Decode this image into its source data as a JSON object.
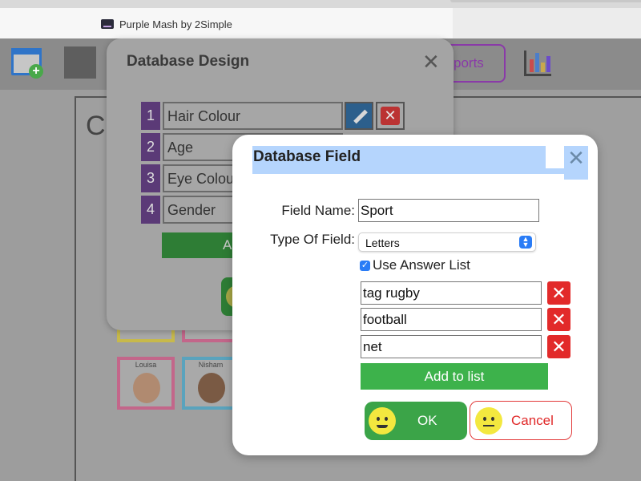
{
  "browser": {
    "tab_title": "Purple Mash by 2Simple"
  },
  "toolbar": {
    "reports_label": "ports"
  },
  "canvas": {
    "partial_heading": "C"
  },
  "cards": [
    {
      "name": "Louisa"
    },
    {
      "name": "Nisham"
    }
  ],
  "design_dialog": {
    "title": "Database Design",
    "fields": [
      {
        "num": "1",
        "name": "Hair Colour"
      },
      {
        "num": "2",
        "name": "Age"
      },
      {
        "num": "3",
        "name": "Eye Colour"
      },
      {
        "num": "4",
        "name": "Gender"
      }
    ],
    "add_partial": "A"
  },
  "field_dialog": {
    "title": "Database Field",
    "field_name_label": "Field Name:",
    "field_name_value": "Sport",
    "type_label": "Type Of Field:",
    "type_value": "Letters",
    "use_answer_list_label": "Use Answer List",
    "use_answer_list_checked": true,
    "answers": [
      "tag rugby",
      "football",
      "net"
    ],
    "add_to_list_label": "Add to list",
    "ok_label": "OK",
    "cancel_label": "Cancel"
  },
  "colors": {
    "accent_purple": "#8a3aa8",
    "ok_green": "#3ba448",
    "delete_red": "#e22a2a",
    "selection_blue": "#b5d5fd"
  }
}
